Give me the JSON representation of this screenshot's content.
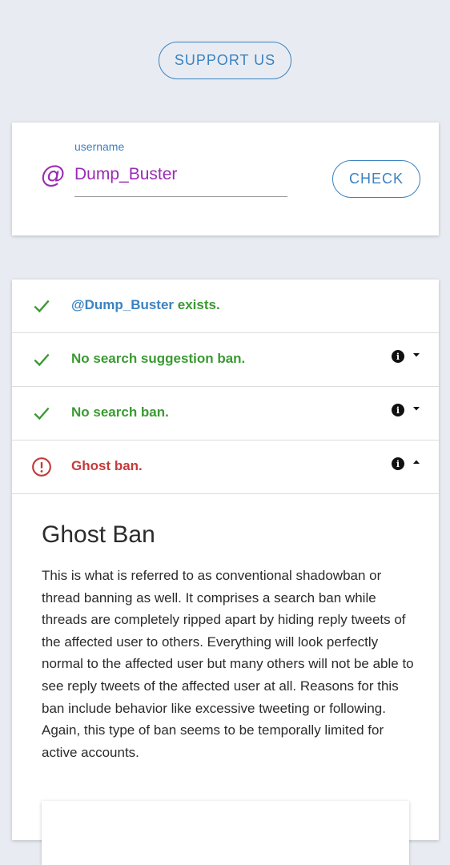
{
  "support": {
    "label": "SUPPORT US"
  },
  "form": {
    "label": "username",
    "at_symbol": "@",
    "value": "Dump_Buster",
    "check_label": "CHECK"
  },
  "results": [
    {
      "handle": "@Dump_Buster",
      "text": " exists.",
      "status": "ok",
      "icon": "check-icon",
      "has_info": false
    },
    {
      "text": "No search suggestion ban.",
      "status": "ok",
      "icon": "check-icon",
      "has_info": true,
      "expanded": false
    },
    {
      "text": "No search ban.",
      "status": "ok",
      "icon": "check-icon",
      "has_info": true,
      "expanded": false
    },
    {
      "text": "Ghost ban.",
      "status": "banned",
      "icon": "alert-circle-icon",
      "has_info": true,
      "expanded": true
    }
  ],
  "detail": {
    "title": "Ghost Ban",
    "body": "This is what is referred to as conventional shadowban or thread banning as well. It comprises a search ban while threads are completely ripped apart by hiding reply tweets of the affected user to others. Everything will look perfectly normal to the affected user but many others will not be able to see reply tweets of the affected user at all. Reasons for this ban include behavior like excessive tweeting or following. Again, this type of ban seems to be temporally limited for active accounts."
  },
  "colors": {
    "accent_blue": "#3a82c0",
    "input_purple": "#9b2bb4",
    "ok_green": "#3a9a32",
    "ban_red": "#c43a3a",
    "background": "#e8ecf2"
  }
}
